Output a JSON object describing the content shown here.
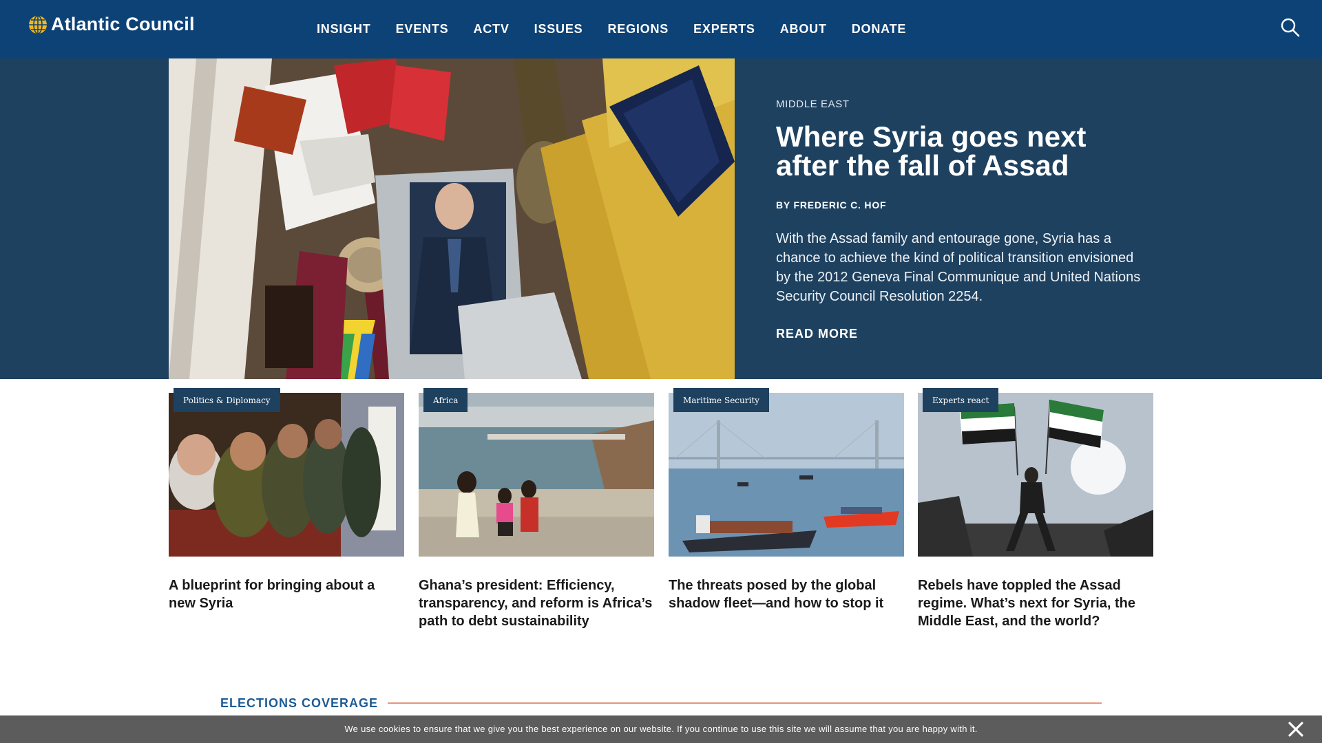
{
  "header": {
    "logo_text": "Atlantic Council",
    "nav": [
      "INSIGHT",
      "EVENTS",
      "ACTV",
      "ISSUES",
      "REGIONS",
      "EXPERTS",
      "ABOUT",
      "DONATE"
    ],
    "search_icon": "search-icon"
  },
  "hero": {
    "kicker": "MIDDLE EAST",
    "title": "Where Syria goes next after the fall of Assad",
    "byline": "BY FREDERIC C. HOF",
    "summary": "With the Assad family and entourage gone, Syria has a chance to achieve the kind of political transition envisioned by the 2012 Geneva Final Communique and United Nations Security Council Resolution 2254.",
    "read_more": "READ MORE"
  },
  "cards": [
    {
      "tag": "Politics & Diplomacy",
      "title": "A blueprint for bringing about a new Syria"
    },
    {
      "tag": "Africa",
      "title": "Ghana’s president: Efficiency, transparency, and reform is Africa’s path to debt sustainability"
    },
    {
      "tag": "Maritime Security",
      "title": "The threats posed by the global shadow fleet—and how to stop it"
    },
    {
      "tag": "Experts react",
      "title": "Rebels have toppled the Assad regime. What’s next for Syria, the Middle East, and the world?"
    }
  ],
  "section": {
    "label": "ELECTIONS COVERAGE"
  },
  "cookie": {
    "text": "We use cookies to ensure that we give you the best experience on our website. If you continue to use this site we will assume that you are happy with it."
  },
  "colors": {
    "header_bg": "#0d4277",
    "hero_bg": "#1e4160",
    "tag_bg": "#1e4160",
    "section_label": "#1d5b95",
    "section_rule": "#e7967a",
    "cookie_bg": "#5c5c5c",
    "logo_accent": "#f2b81c"
  }
}
